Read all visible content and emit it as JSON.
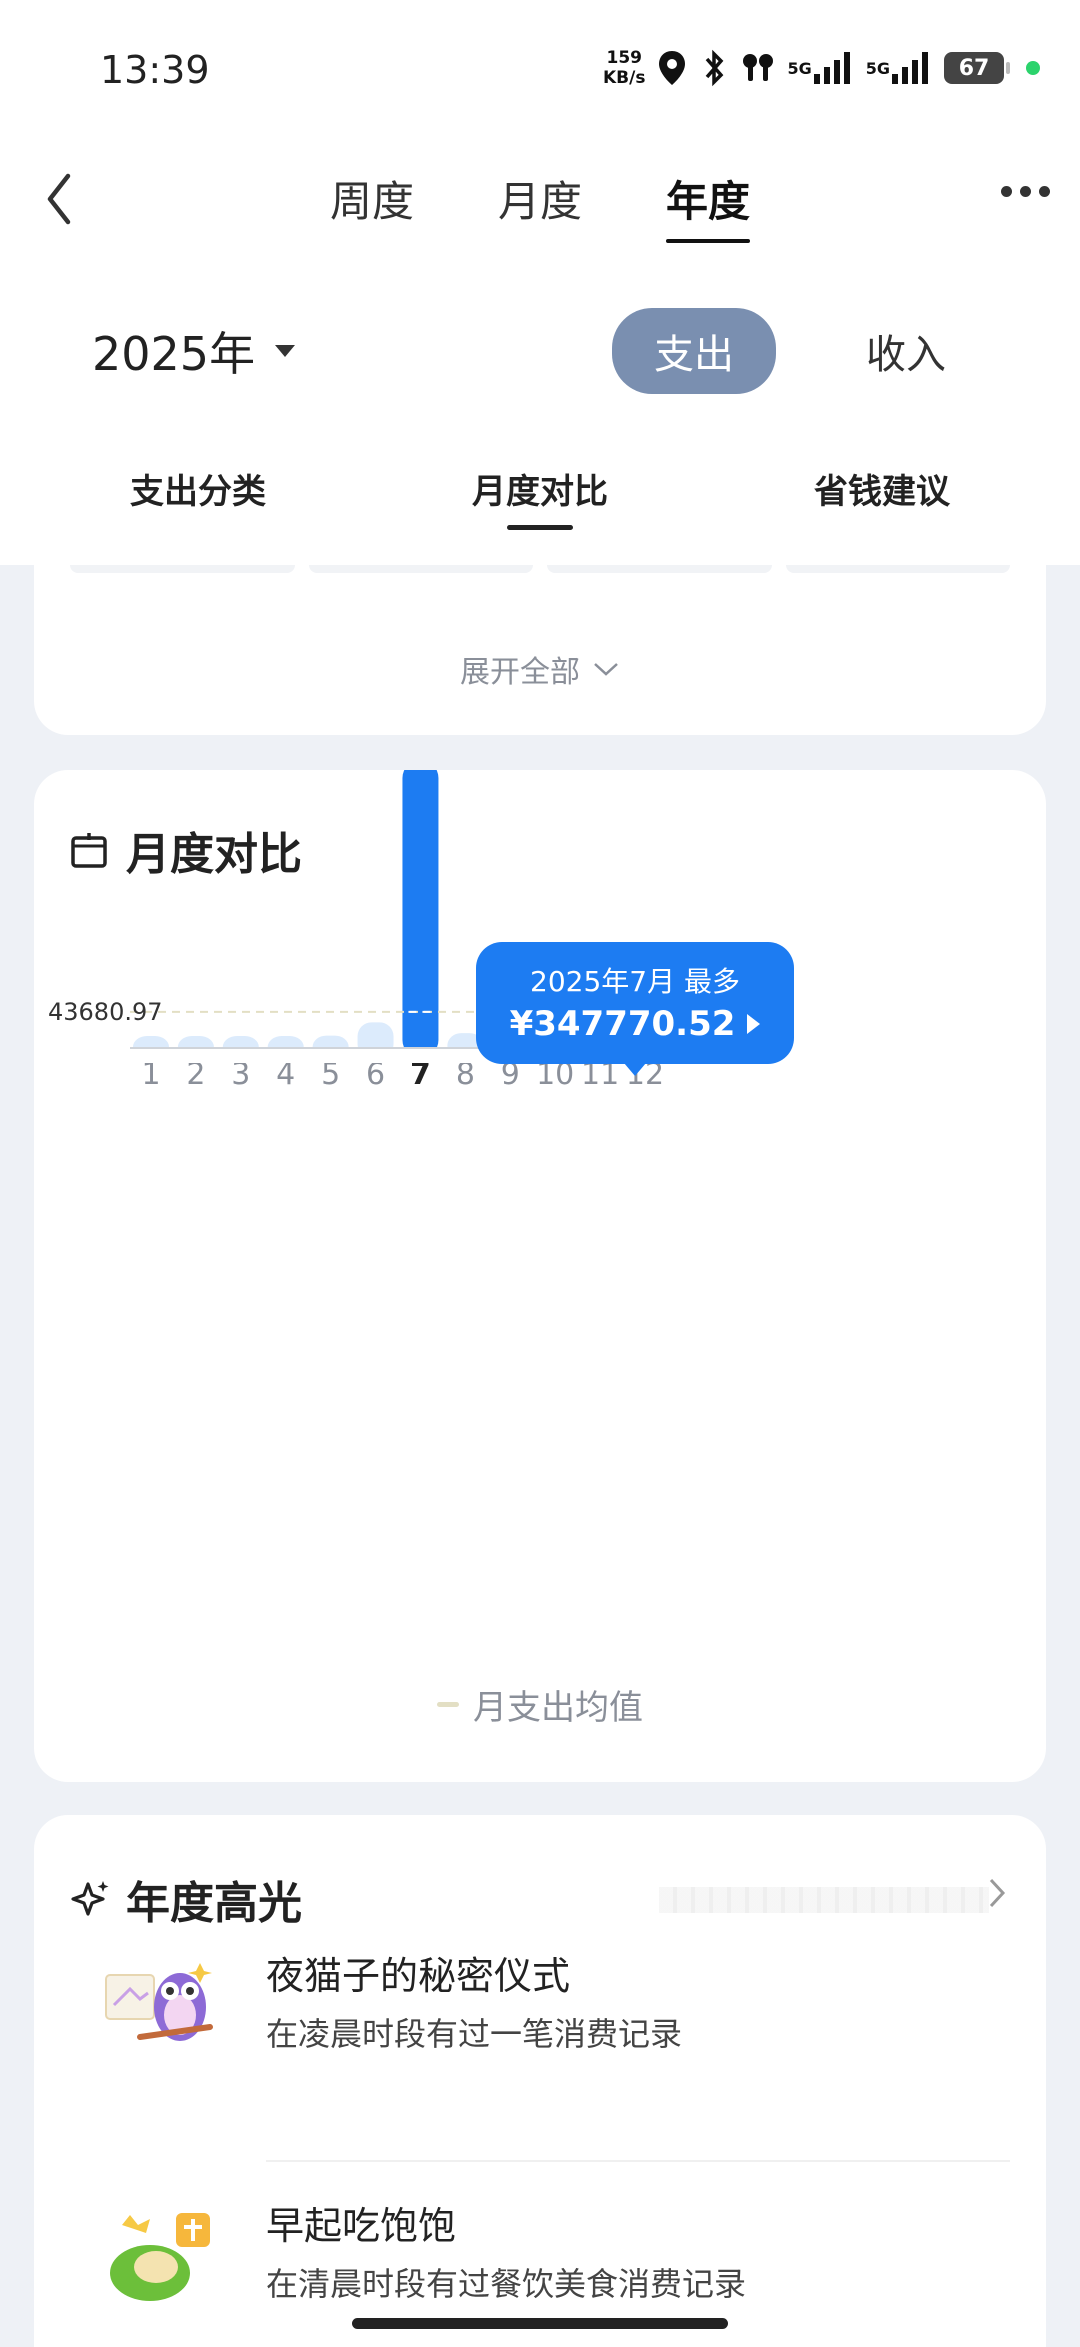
{
  "status": {
    "time": "13:39",
    "net_speed_value": "159",
    "net_speed_unit": "KB/s",
    "signal1": "5G",
    "signal2": "5G",
    "battery": "67"
  },
  "nav": {
    "tabs": [
      "周度",
      "月度",
      "年度"
    ],
    "active_tab": "年度"
  },
  "filter": {
    "year": "2025年",
    "toggle": [
      "支出",
      "收入"
    ],
    "active_toggle": "支出"
  },
  "subtabs": {
    "items": [
      "支出分类",
      "月度对比",
      "省钱建议"
    ],
    "active": "月度对比"
  },
  "category_card": {
    "expand_label": "展开全部"
  },
  "monthly": {
    "title": "月度对比",
    "tooltip_label": "2025年7月 最多",
    "tooltip_value": "¥347770.52",
    "legend": "月支出均值",
    "accent_color": "#1d7cf2",
    "bar_color": "#dcebfc"
  },
  "chart_data": {
    "type": "bar",
    "categories": [
      "1",
      "2",
      "3",
      "4",
      "5",
      "6",
      "7",
      "8",
      "9",
      "10",
      "11",
      "12"
    ],
    "values": [
      8000,
      13000,
      9000,
      7000,
      15000,
      31000,
      347770.52,
      18000,
      20000,
      10000,
      11000,
      28000
    ],
    "highlight_index": 6,
    "reference_line": {
      "label": "月支出均值",
      "value": 43680.97,
      "value_label": "43680.97"
    },
    "ylim": [
      0,
      380000
    ]
  },
  "highlights": {
    "title": "年度高光",
    "items": [
      {
        "title": "夜猫子的秘密仪式",
        "desc": "在凌晨时段有过一笔消费记录",
        "icon": "owl-icon"
      },
      {
        "title": "早起吃饱饱",
        "desc": "在清晨时段有过餐饮美食消费记录",
        "icon": "breakfast-icon"
      }
    ]
  }
}
